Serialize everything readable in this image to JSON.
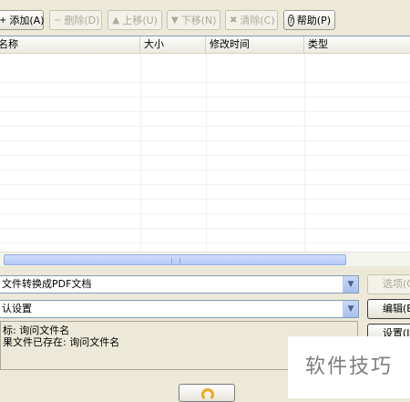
{
  "toolbar": {
    "add": "添加(A)",
    "delete": "删除(D)",
    "up": "上移(U)",
    "down": "下移(N)",
    "clear": "清除(C)",
    "help": "帮助(P)"
  },
  "list": {
    "columns": [
      "名称",
      "大小",
      "修改时间",
      "类型"
    ],
    "scroll_grip": "|||"
  },
  "convert_combo": {
    "value": "文件转换成PDF文档"
  },
  "options_button": "选项(O",
  "settings_combo": {
    "value": "认设置"
  },
  "edit_button": "编辑(E",
  "config_button": "设置(I",
  "info": {
    "line1": "标: 询问文件名",
    "line2": "果文件已存在: 询问文件名"
  },
  "watermark": "软件技巧",
  "colors": {
    "accent": "#7f9db9",
    "watermark": "#7d7d7d",
    "icon": "#f0a91a"
  }
}
